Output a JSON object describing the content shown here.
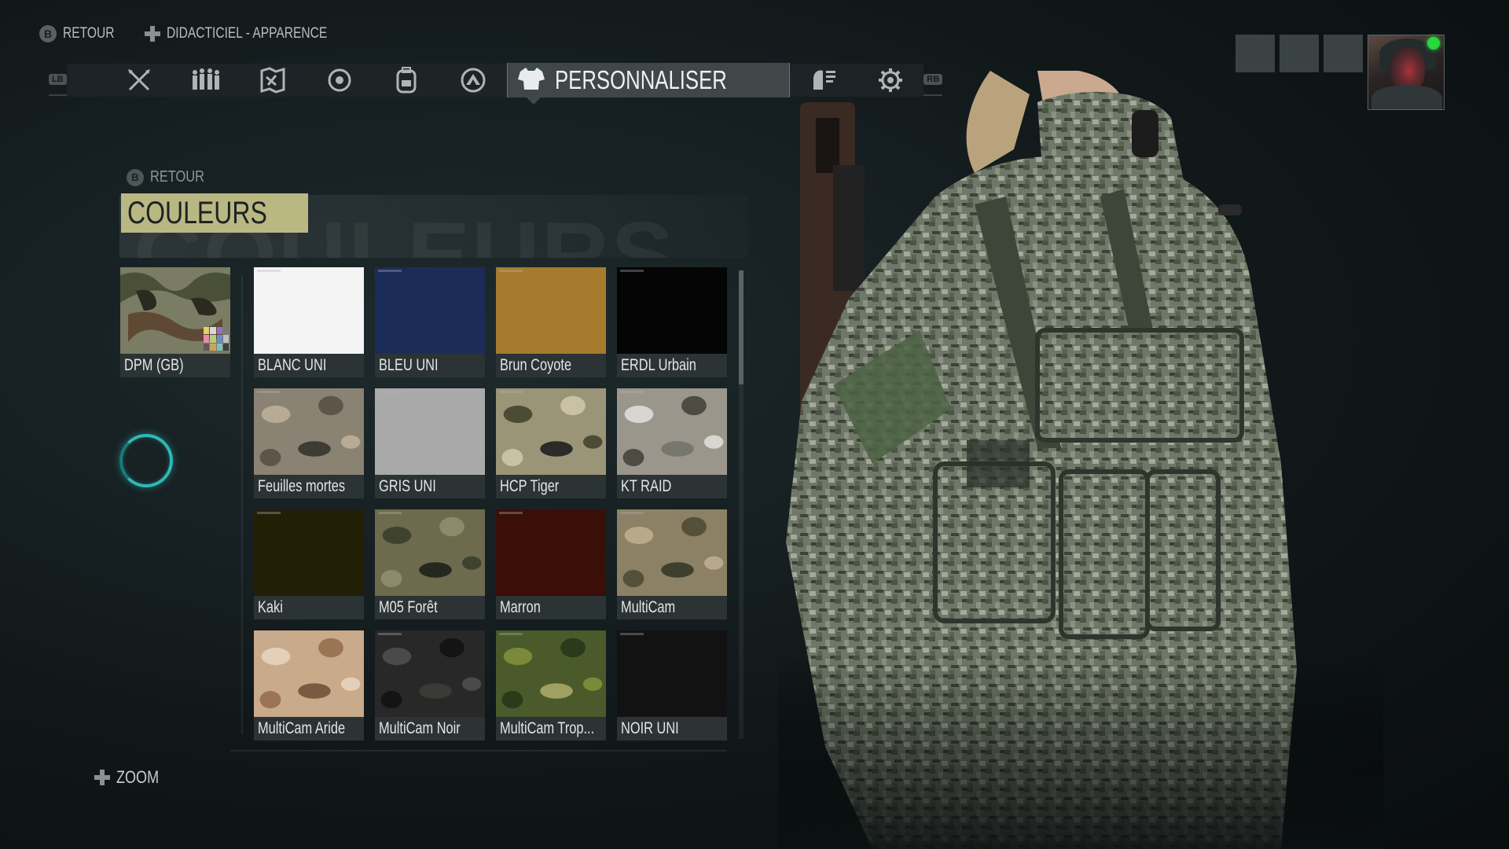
{
  "top_hints": {
    "back": "RETOUR",
    "tutorial": "DIDACTICIEL - APPARENCE"
  },
  "nav": {
    "left_bumper": "LB",
    "right_bumper": "RB",
    "active_label": "PERSONNALISER",
    "icons": [
      "crossed-weapons-icon",
      "squad-icon",
      "map-icon",
      "target-icon",
      "backpack-icon",
      "emblem-icon",
      "customize-shirt-icon",
      "intel-icon",
      "gear-icon"
    ]
  },
  "section": {
    "back_label": "RETOUR",
    "title": "COULEURS",
    "watermark": "COULEURS"
  },
  "selected": {
    "label": "DPM (GB)"
  },
  "grid": [
    {
      "label": "BLANC UNI",
      "color": "#f4f4f4"
    },
    {
      "label": "BLEU UNI",
      "color": "#1c2c58"
    },
    {
      "label": "Brun Coyote",
      "color": "#a67b2e"
    },
    {
      "label": "ERDL Urbain",
      "color": "#050505"
    },
    {
      "label": "Feuilles mortes",
      "color": "#8a8272"
    },
    {
      "label": "GRIS UNI",
      "color": "#a9a9a9"
    },
    {
      "label": "HCP Tiger",
      "color": "#9a9577"
    },
    {
      "label": "KT RAID",
      "color": "#9a968c"
    },
    {
      "label": "Kaki",
      "color": "#221f07"
    },
    {
      "label": "M05 Forêt",
      "color": "#6d6a4d"
    },
    {
      "label": "Marron",
      "color": "#3a0f07"
    },
    {
      "label": "MultiCam",
      "color": "#8c8065"
    },
    {
      "label": "MultiCam Aride",
      "color": "#c9aa8a"
    },
    {
      "label": "MultiCam Noir",
      "color": "#282828"
    },
    {
      "label": "MultiCam Trop...",
      "color": "#4a5a2a"
    },
    {
      "label": "NOIR UNI",
      "color": "#121212"
    }
  ],
  "bottom_hint": {
    "zoom": "ZOOM"
  },
  "colors": {
    "accent_title": "#b9b883",
    "spinner": "#2fb8b8",
    "online": "#27d83e"
  }
}
